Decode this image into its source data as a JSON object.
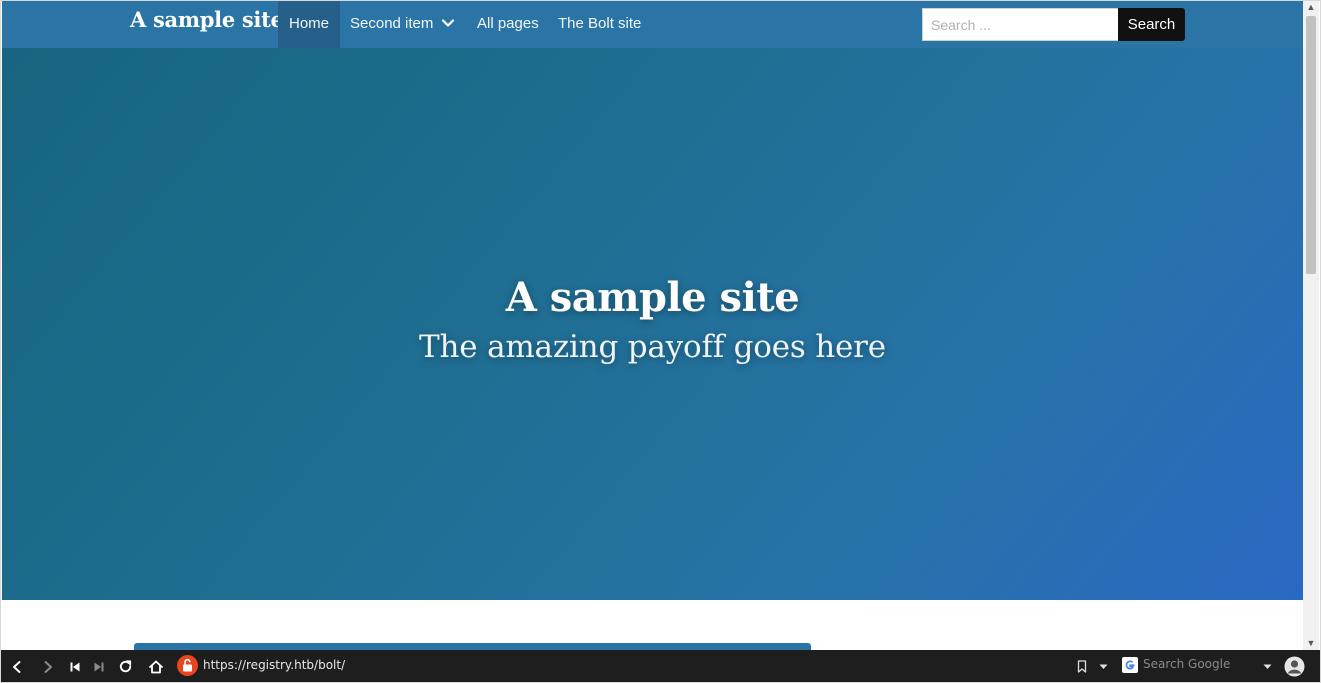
{
  "site": {
    "brand": "A sample site",
    "nav": [
      {
        "label": "Home",
        "active": true
      },
      {
        "label": "Second item",
        "has_dropdown": true
      },
      {
        "label": "All pages"
      },
      {
        "label": "The Bolt site"
      }
    ],
    "search": {
      "placeholder": "Search ...",
      "value": "",
      "button_label": "Search"
    }
  },
  "hero": {
    "title": "A sample site",
    "subtitle": "The amazing payoff goes here"
  },
  "browser": {
    "url": "https://registry.htb/bolt/",
    "search_engine_placeholder": "Search Google",
    "lock_color": "#e8461e"
  },
  "colors": {
    "navbar": "#2b75a6",
    "nav_active": "#265f89",
    "hero_start": "#17657f",
    "hero_end": "#2a69c4",
    "search_button": "#111111"
  }
}
